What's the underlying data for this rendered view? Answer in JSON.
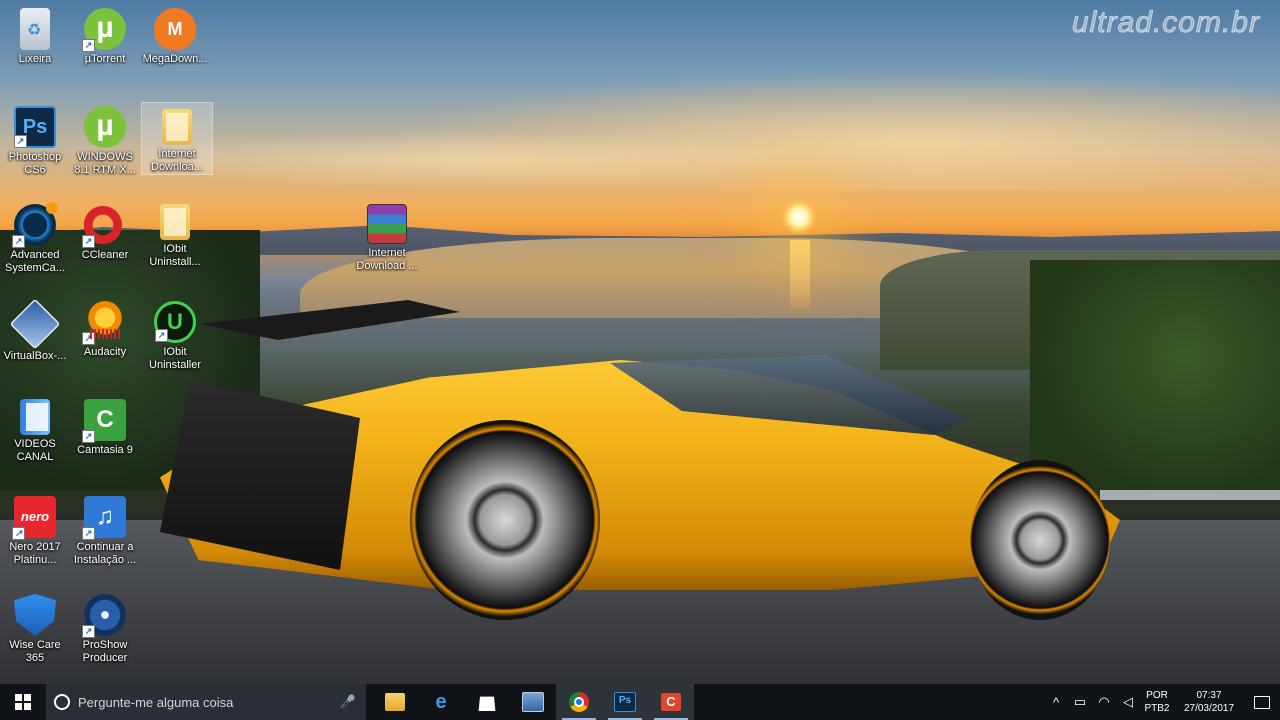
{
  "watermark": "ultrad.com.br",
  "desktop_icons": [
    {
      "label": "Lixeira",
      "icon": "recycle-bin-icon"
    },
    {
      "label": "µTorrent",
      "icon": "utorrent-icon"
    },
    {
      "label": "MegaDown...",
      "icon": "mega-icon"
    },
    {
      "label": "Photoshop CS6",
      "icon": "photoshop-icon"
    },
    {
      "label": "WINDOWS 8.1 RTM X...",
      "icon": "utorrent-icon"
    },
    {
      "label": "Internet Downloa...",
      "icon": "folder-icon"
    },
    {
      "label": "Advanced SystemCa...",
      "icon": "advanced-systemcare-icon"
    },
    {
      "label": "CCleaner",
      "icon": "ccleaner-icon"
    },
    {
      "label": "IObit Uninstall...",
      "icon": "folder-icon"
    },
    {
      "label": "Internet Download ...",
      "icon": "winrar-icon"
    },
    {
      "label": "VirtualBox-...",
      "icon": "virtualbox-icon"
    },
    {
      "label": "Audacity",
      "icon": "audacity-icon"
    },
    {
      "label": "IObit Uninstaller",
      "icon": "iobit-uninstaller-icon"
    },
    {
      "label": "VIDEOS CANAL",
      "icon": "folder-icon"
    },
    {
      "label": "Camtasia 9",
      "icon": "camtasia-icon"
    },
    {
      "label": "Nero 2017 Platinu...",
      "icon": "nero-icon"
    },
    {
      "label": "Continuar a Instalação ...",
      "icon": "music-note-icon"
    },
    {
      "label": "Wise Care 365",
      "icon": "wise-care-icon"
    },
    {
      "label": "ProShow Producer",
      "icon": "proshow-icon"
    }
  ],
  "taskbar": {
    "search_placeholder": "Pergunte-me alguma coisa",
    "apps": [
      "file-explorer-icon",
      "edge-icon",
      "store-icon",
      "monitor-icon",
      "chrome-icon",
      "photoshop-icon",
      "camtasia-icon"
    ],
    "language_top": "POR",
    "language_bottom": "PTB2",
    "time": "07:37",
    "date": "27/03/2017"
  }
}
